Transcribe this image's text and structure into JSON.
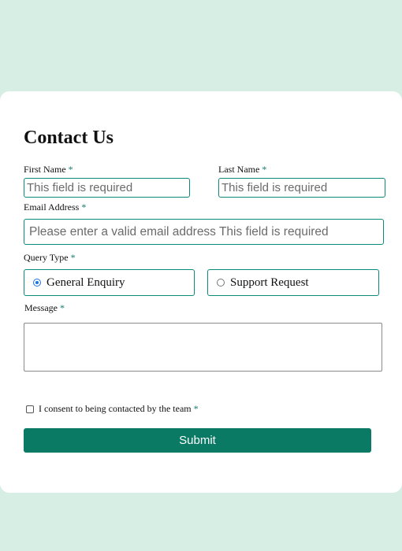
{
  "form": {
    "title": "Contact Us",
    "required_marker": "*",
    "first_name": {
      "label": "First Name",
      "value": "This field is required"
    },
    "last_name": {
      "label": "Last Name",
      "value": "This field is required"
    },
    "email": {
      "label": "Email Address",
      "value": "Please enter a valid email address This field is required"
    },
    "query_type": {
      "label": "Query Type",
      "options": [
        {
          "label": "General Enquiry",
          "selected": true
        },
        {
          "label": "Support Request",
          "selected": false
        }
      ]
    },
    "message": {
      "label": "Message",
      "value": ""
    },
    "consent": {
      "label": "I consent to being contacted by the team",
      "checked": false
    },
    "submit_label": "Submit"
  },
  "colors": {
    "page_background": "#d7eee4",
    "card_background": "#ffffff",
    "accent": "#0c8a7a",
    "button": "#0a7a64",
    "radio_selected": "#1a73e8"
  },
  "icons": {
    "radio_selected": "radio-selected-icon",
    "radio_unselected": "radio-unselected-icon",
    "checkbox": "checkbox-icon"
  }
}
